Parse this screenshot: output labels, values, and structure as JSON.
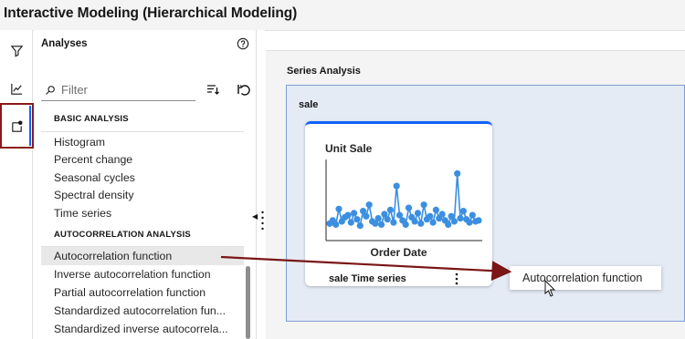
{
  "app": {
    "title": "Interactive Modeling (Hierarchical Modeling)"
  },
  "rail": {
    "items": [
      {
        "name": "filter-icon"
      },
      {
        "name": "line-chart-icon"
      },
      {
        "name": "add-analysis-icon",
        "active": true
      }
    ],
    "active_border_color": "#8b1a1a"
  },
  "analyses_panel": {
    "title": "Analyses",
    "help_icon": "help-icon",
    "filter_placeholder": "Filter",
    "sections": [
      {
        "heading": "BASIC ANALYSIS",
        "items": [
          "Histogram",
          "Percent change",
          "Seasonal cycles",
          "Spectral density",
          "Time series"
        ]
      },
      {
        "heading": "AUTOCORRELATION ANALYSIS",
        "items": [
          "Autocorrelation function",
          "Inverse autocorrelation function",
          "Partial autocorrelation function",
          "Standardized autocorrelation fun...",
          "Standardized inverse autocorrela..."
        ]
      }
    ],
    "highlighted_item": "Autocorrelation function"
  },
  "series_analysis": {
    "title": "Series Analysis",
    "variable": "sale",
    "tile": {
      "chart_title": "Unit Sale",
      "x_label": "Order Date",
      "footer": "sale Time series"
    },
    "drag_ghost": "Autocorrelation function"
  },
  "colors": {
    "accent": "#0f62fe",
    "drop_zone_bg": "#e5ebf5",
    "drop_zone_border": "#7b9fd6",
    "point": "#3b8fe0",
    "arrow": "#7a1616"
  },
  "chart_data": {
    "type": "line",
    "title": "Unit Sale",
    "xlabel": "Order Date",
    "ylabel": "",
    "x": [
      1,
      2,
      3,
      4,
      5,
      6,
      7,
      8,
      9,
      10,
      11,
      12,
      13,
      14,
      15,
      16,
      17,
      18,
      19,
      20,
      21,
      22,
      23,
      24,
      25,
      26,
      27,
      28,
      29,
      30,
      31,
      32,
      33,
      34,
      35,
      36,
      37,
      38,
      39,
      40,
      41,
      42,
      43,
      44,
      45,
      46,
      47,
      48,
      49,
      50
    ],
    "series": [
      {
        "values": [
          12,
          15,
          11,
          26,
          14,
          18,
          20,
          13,
          22,
          16,
          10,
          24,
          19,
          30,
          14,
          12,
          17,
          11,
          21,
          16,
          25,
          13,
          48,
          20,
          15,
          11,
          27,
          18,
          14,
          22,
          12,
          30,
          16,
          19,
          13,
          25,
          17,
          21,
          15,
          11,
          19,
          14,
          60,
          17,
          24,
          16,
          13,
          20,
          14,
          15
        ]
      }
    ],
    "ylim": [
      0,
      70
    ],
    "grid": false
  }
}
